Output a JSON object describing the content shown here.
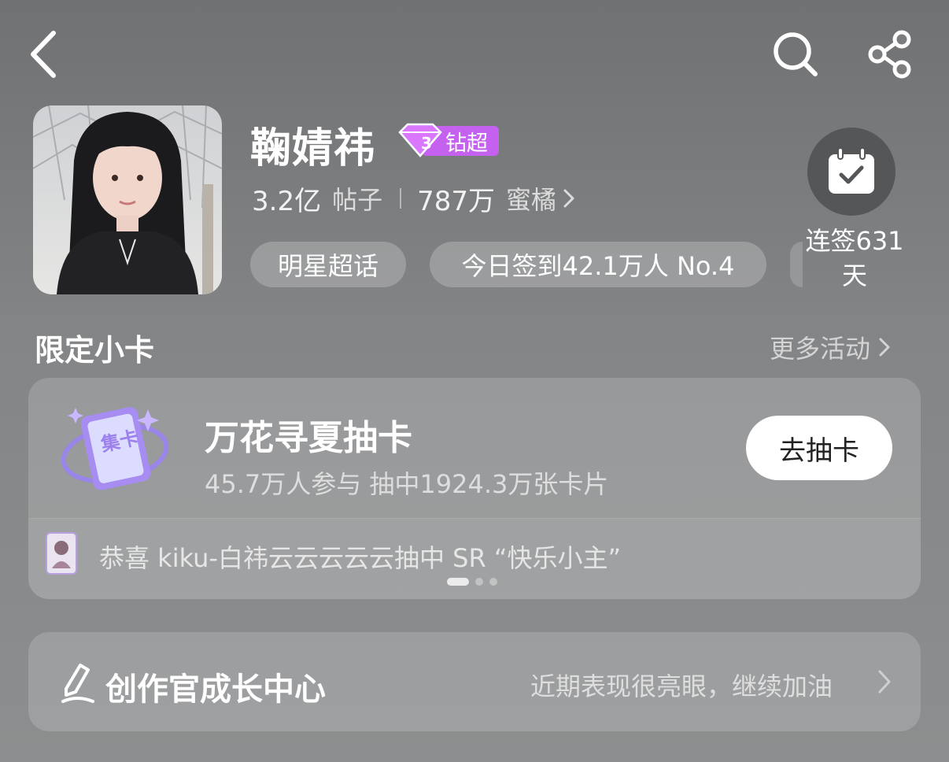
{
  "header": {
    "back_icon": "chevron-left-icon",
    "search_icon": "search-icon",
    "share_icon": "share-icon"
  },
  "profile": {
    "name": "鞠婧祎",
    "badge": {
      "label": "钻超",
      "level": "3",
      "icon": "diamond-icon",
      "color": "#c561ef"
    },
    "stats": {
      "posts_value": "3.2亿",
      "posts_unit": "帖子",
      "fans_value": "787万",
      "fans_unit": "蜜橘"
    },
    "pills": [
      "明星超话",
      "今日签到42.1万人 No.4"
    ],
    "checkin": {
      "icon": "calendar-check-icon",
      "label_line1": "连签631",
      "label_line2": "天"
    }
  },
  "section": {
    "title": "限定小卡",
    "more_label": "更多活动"
  },
  "card": {
    "icon_text": "集卡",
    "title": "万花寻夏抽卡",
    "subtitle": "45.7万人参与 抽中1924.3万张卡片",
    "button_label": "去抽卡",
    "winner_text": "恭喜 kiku-白祎云云云云云抽中 SR “快乐小主”",
    "carousel": {
      "count": 3,
      "active": 0
    }
  },
  "creator": {
    "title": "创作官成长中心",
    "hint": "近期表现很亮眼，继续加油"
  },
  "colors": {
    "background": "#7a7c7e",
    "card_accent": "#a98ff0",
    "badge": "#c561ef"
  }
}
